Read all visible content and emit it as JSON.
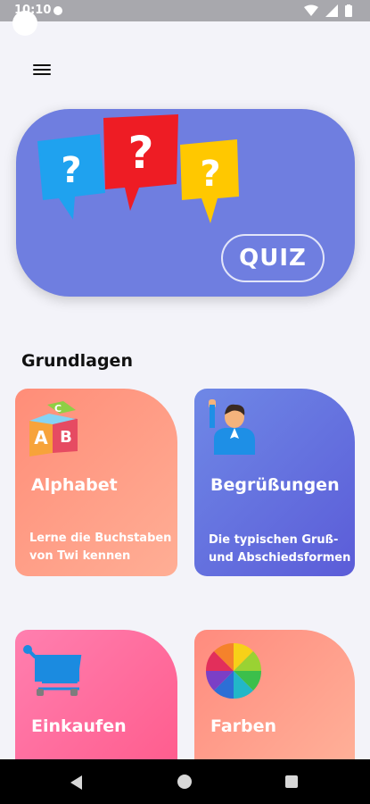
{
  "status_bar": {
    "time": "10:10"
  },
  "hero": {
    "button_label": "QUIZ"
  },
  "section_title": "Grundlagen",
  "cards": [
    {
      "title": "Alphabet",
      "description_line1": "Lerne die Buchstaben",
      "description_line2": "von Twi kennen",
      "icon": "abc-blocks-icon"
    },
    {
      "title": "Begrüßungen",
      "description_line1": "Die typischen Gruß-",
      "description_line2": "und Abschiedsformen",
      "icon": "waving-person-icon"
    },
    {
      "title": "Einkaufen",
      "icon": "shopping-cart-icon"
    },
    {
      "title": "Farben",
      "icon": "color-wheel-icon"
    }
  ],
  "colors": {
    "hero": "#6f7ee0",
    "card_alphabet": "#ff9a84",
    "card_greetings": "#6270e0",
    "card_shopping": "#ff6f9f",
    "card_colors": "#ff9c8a"
  }
}
